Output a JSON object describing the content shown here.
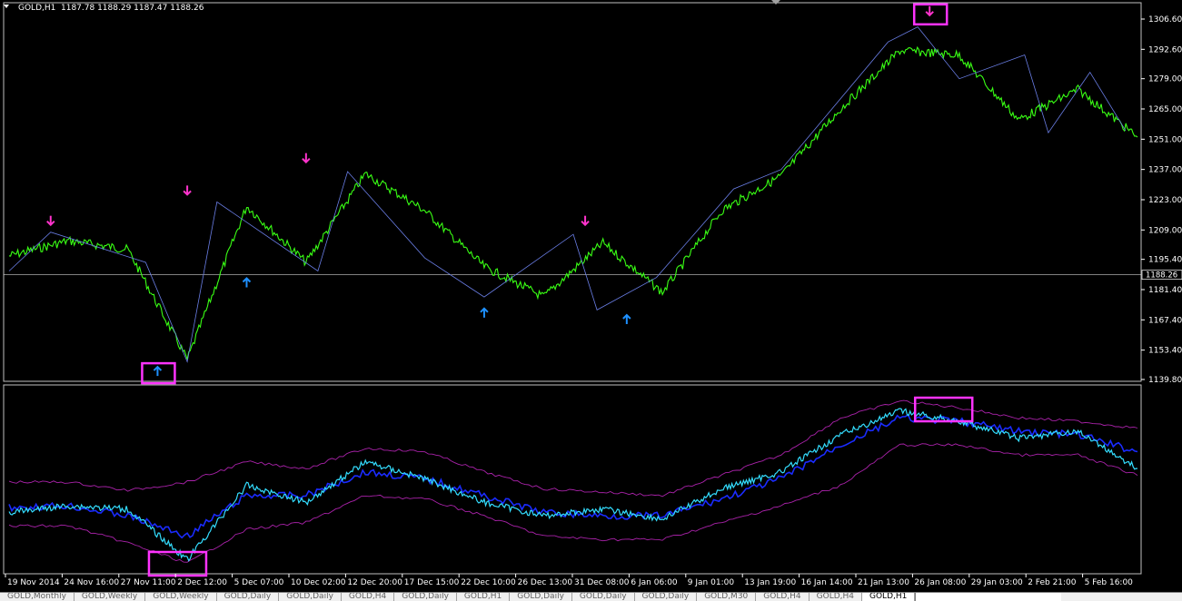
{
  "header": {
    "symbol": "GOLD,H1",
    "ohlc": "1187.78 1188.29 1187.47 1188.26",
    "dropdown_icon": "triangle-down-icon"
  },
  "colors": {
    "background": "#000000",
    "price": "#39ff14",
    "price_line": "#ffffff",
    "zigzag": "#6a7ee6",
    "arrow_up": "#1e90ff",
    "arrow_down": "#ff33cc",
    "highlight_box": "#ff33ff",
    "osc_main": "#33ddff",
    "osc_ma": "#1a2bff",
    "osc_bands": "#aa22aa",
    "axis_text": "#ffffff",
    "current_price_label": "#ffffff"
  },
  "chart_data": {
    "type": "line",
    "title": "",
    "xlabel": "",
    "ylabel": "",
    "price_axis": {
      "ticks": [
        1306.6,
        1292.6,
        1279.0,
        1265.0,
        1251.0,
        1237.0,
        1223.0,
        1209.0,
        1195.4,
        1181.4,
        1167.4,
        1153.4,
        1139.8
      ],
      "tick_labels": [
        "1306.60",
        "1292.60",
        "1279.00",
        "1265.00",
        "1251.00",
        "1237.00",
        "1223.00",
        "1209.00",
        "1195.40",
        "1181.40",
        "1167.40",
        "1153.40",
        "1139.80"
      ],
      "ylim": [
        1139.8,
        1306.6
      ],
      "current_price": 1188.26,
      "current_price_label": "1188.26"
    },
    "time_axis": {
      "labels": [
        "19 Nov 2014",
        "24 Nov 16:00",
        "27 Nov 11:00",
        "2 Dec 12:00",
        "5 Dec 07:00",
        "10 Dec 02:00",
        "12 Dec 20:00",
        "17 Dec 15:00",
        "22 Dec 10:00",
        "26 Dec 13:00",
        "31 Dec 08:00",
        "6 Jan 06:00",
        "9 Jan 01:00",
        "13 Jan 19:00",
        "16 Jan 14:00",
        "21 Jan 13:00",
        "26 Jan 08:00",
        "29 Jan 03:00",
        "2 Feb 21:00",
        "5 Feb 16:00"
      ]
    },
    "series": [
      {
        "role": "price",
        "x": [
          0,
          1,
          2,
          3,
          4,
          5,
          6,
          7,
          8,
          9,
          10,
          11,
          12,
          13,
          14,
          15,
          16,
          17,
          18,
          19
        ],
        "y": [
          1197,
          1204,
          1200,
          1149,
          1220,
          1194,
          1235,
          1218,
          1192,
          1178,
          1203,
          1180,
          1218,
          1234,
          1265,
          1292,
          1290,
          1260,
          1274,
          1252
        ]
      }
    ],
    "zigzag": {
      "x": [
        0,
        0.7,
        2.3,
        3.0,
        3.5,
        5.2,
        5.7,
        7.0,
        8.0,
        9.5,
        9.9,
        10.9,
        12.2,
        13.0,
        14.8,
        15.3,
        16.0,
        17.1,
        17.5,
        18.2,
        18.8
      ],
      "y": [
        1190,
        1208,
        1194,
        1148,
        1222,
        1190,
        1236,
        1196,
        1178,
        1207,
        1172,
        1187,
        1228,
        1237,
        1296,
        1303,
        1279,
        1290,
        1254,
        1282,
        1255
      ]
    },
    "signals": [
      {
        "type": "sell",
        "x": 0.7,
        "y": 1208
      },
      {
        "type": "buy",
        "x": 2.5,
        "y": 1149,
        "highlight": true
      },
      {
        "type": "sell",
        "x": 3.0,
        "y": 1222
      },
      {
        "type": "buy",
        "x": 4.0,
        "y": 1190
      },
      {
        "type": "sell",
        "x": 5.0,
        "y": 1237
      },
      {
        "type": "buy",
        "x": 8.0,
        "y": 1176
      },
      {
        "type": "sell",
        "x": 9.7,
        "y": 1208
      },
      {
        "type": "buy",
        "x": 10.4,
        "y": 1173
      },
      {
        "type": "sell",
        "x": 15.5,
        "y": 1305,
        "highlight": true
      }
    ],
    "oscillator": {
      "x": [
        0,
        1,
        2,
        3,
        4,
        5,
        6,
        7,
        8,
        9,
        10,
        11,
        12,
        13,
        14,
        15,
        16,
        17,
        18,
        19
      ],
      "main": [
        0.32,
        0.36,
        0.34,
        0.04,
        0.48,
        0.38,
        0.62,
        0.52,
        0.38,
        0.3,
        0.34,
        0.28,
        0.46,
        0.56,
        0.78,
        0.92,
        0.86,
        0.76,
        0.8,
        0.58
      ],
      "ma": [
        0.35,
        0.36,
        0.3,
        0.18,
        0.42,
        0.42,
        0.56,
        0.52,
        0.42,
        0.32,
        0.3,
        0.3,
        0.4,
        0.52,
        0.72,
        0.88,
        0.86,
        0.8,
        0.78,
        0.68
      ],
      "upper_band": [
        0.5,
        0.5,
        0.45,
        0.5,
        0.62,
        0.58,
        0.7,
        0.68,
        0.56,
        0.46,
        0.44,
        0.42,
        0.54,
        0.66,
        0.88,
        0.98,
        0.94,
        0.88,
        0.86,
        0.82
      ],
      "lower_band": [
        0.24,
        0.24,
        0.14,
        0.02,
        0.22,
        0.26,
        0.42,
        0.4,
        0.3,
        0.18,
        0.16,
        0.16,
        0.26,
        0.36,
        0.48,
        0.72,
        0.72,
        0.66,
        0.66,
        0.54
      ],
      "highlights": [
        2.6,
        15.5
      ]
    }
  },
  "tabs": [
    {
      "label": "GOLD,Monthly"
    },
    {
      "label": "GOLD,Weekly"
    },
    {
      "label": "GOLD,Weekly"
    },
    {
      "label": "GOLD,Daily"
    },
    {
      "label": "GOLD,Daily"
    },
    {
      "label": "GOLD,H4"
    },
    {
      "label": "GOLD,Daily"
    },
    {
      "label": "GOLD,H1"
    },
    {
      "label": "GOLD,Daily"
    },
    {
      "label": "GOLD,Daily"
    },
    {
      "label": "GOLD,Daily"
    },
    {
      "label": "GOLD,M30"
    },
    {
      "label": "GOLD,H4"
    },
    {
      "label": "GOLD,H4"
    },
    {
      "label": "GOLD,H1",
      "active": true
    }
  ]
}
